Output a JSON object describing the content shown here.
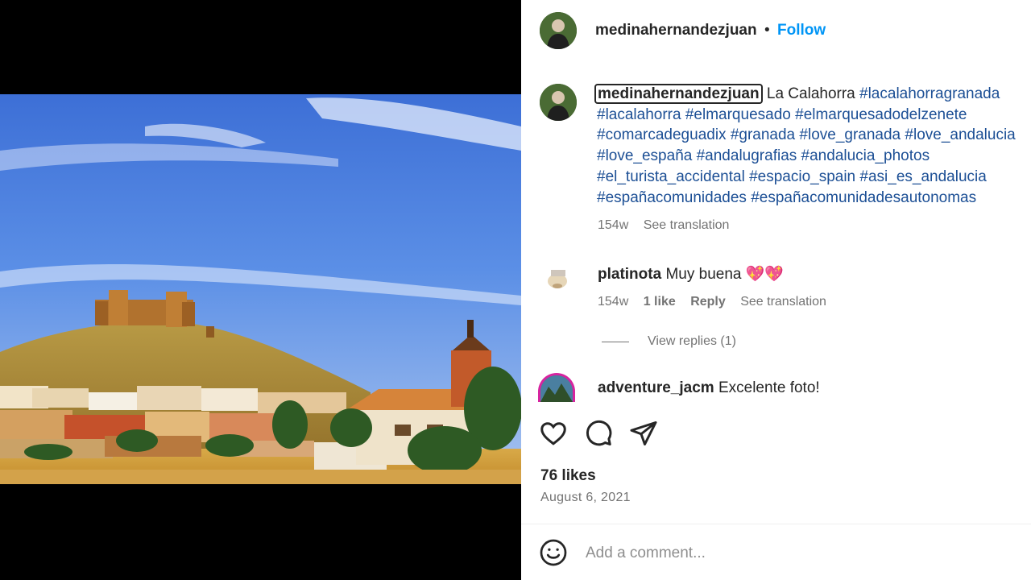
{
  "post": {
    "author": "medinahernandezjuan",
    "separator": "•",
    "follow_label": "Follow"
  },
  "caption": {
    "user": "medinahernandezjuan",
    "text": "La Calahorra",
    "hashtags": [
      "#lacalahorragranada",
      "#lacalahorra",
      "#elmarquesado",
      "#elmarquesadodelzenete",
      "#comarcadeguadix",
      "#granada",
      "#love_granada",
      "#love_andalucia",
      "#love_españa",
      "#andalugrafias",
      "#andalucia_photos",
      "#el_turista_accidental",
      "#espacio_spain",
      "#asi_es_andalucia",
      "#españacomunidades",
      "#españacomunidadesautonomas"
    ],
    "time": "154w",
    "see_translation": "See translation"
  },
  "comments": [
    {
      "user": "platinota",
      "text": "Muy buena 💖💖",
      "time": "154w",
      "likes": "1 like",
      "reply": "Reply",
      "see_translation": "See translation",
      "view_replies": "View replies (1)"
    },
    {
      "user": "adventure_jacm",
      "text": "Excelente foto!"
    }
  ],
  "actions": {
    "like_icon": "heart-icon",
    "comment_icon": "speech-bubble-icon",
    "share_icon": "paper-plane-icon"
  },
  "likes": "76 likes",
  "date": "August 6, 2021",
  "add_comment": {
    "placeholder": "Add a comment...",
    "emoji_icon": "smiley-icon"
  },
  "colors": {
    "follow": "#0095f6",
    "hashtag": "#1c4f95",
    "secondary_text": "#737373",
    "media_background": "#000000"
  }
}
